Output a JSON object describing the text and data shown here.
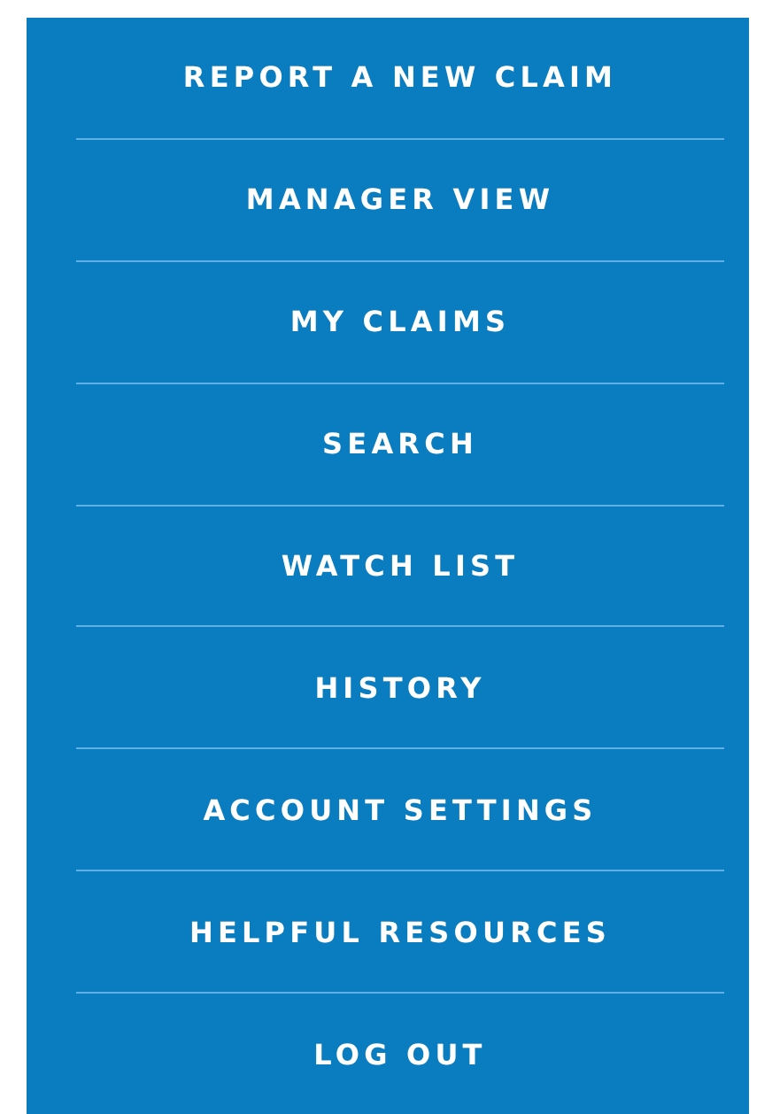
{
  "menu": {
    "items": [
      {
        "label": "REPORT A NEW CLAIM"
      },
      {
        "label": "MANAGER VIEW"
      },
      {
        "label": "MY CLAIMS"
      },
      {
        "label": "SEARCH"
      },
      {
        "label": "WATCH LIST"
      },
      {
        "label": "HISTORY"
      },
      {
        "label": "ACCOUNT SETTINGS"
      },
      {
        "label": "HELPFUL RESOURCES"
      },
      {
        "label": "LOG OUT"
      }
    ]
  }
}
